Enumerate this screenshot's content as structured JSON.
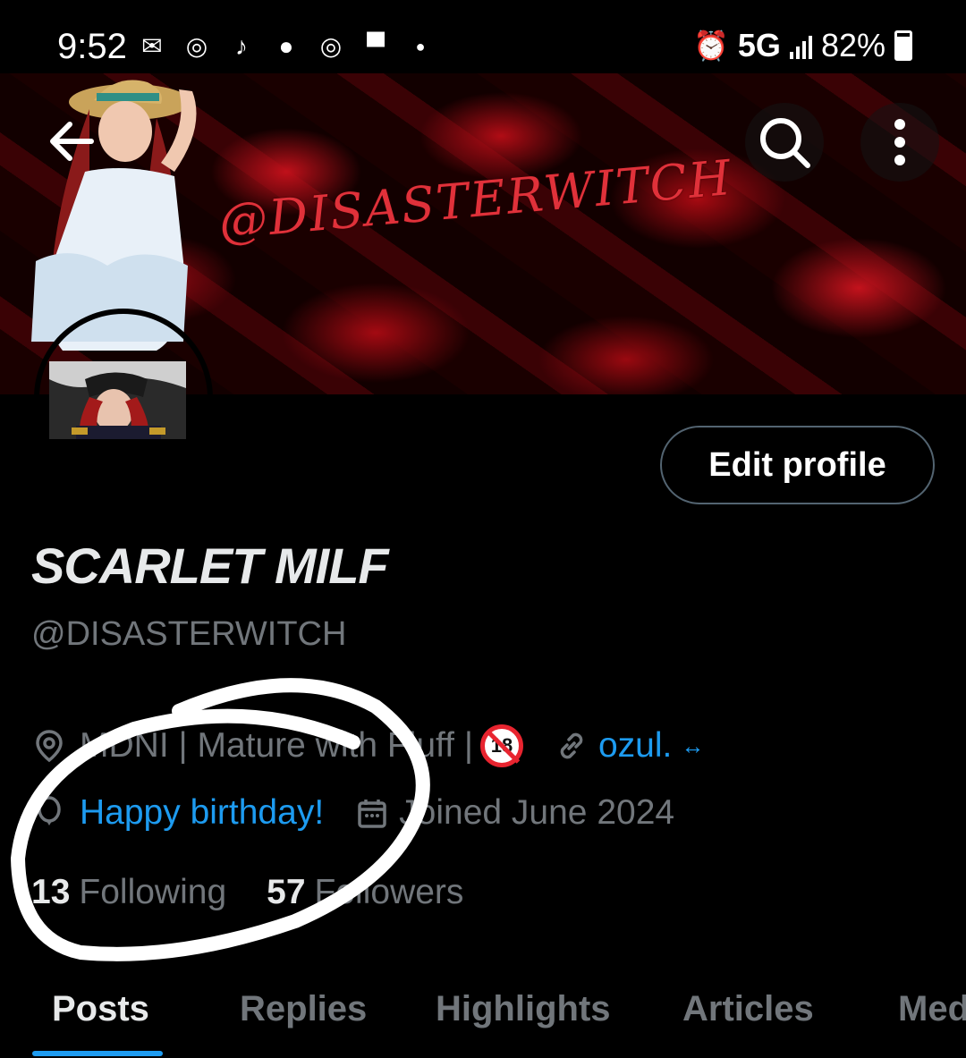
{
  "status_bar": {
    "time": "9:52",
    "notification_icons": [
      "mail-icon",
      "instagram-icon",
      "tiktok-icon",
      "tinder-icon",
      "instagram-icon",
      "top-hat-icon",
      "dot-icon"
    ],
    "alarm_icon": "alarm-icon",
    "network": "5G",
    "battery": "82%"
  },
  "banner": {
    "handle_art_text": "@DISASTERWITCH"
  },
  "profile": {
    "edit_button": "Edit profile",
    "display_name": "SCARLET MILF",
    "handle": "@DISASTERWITCH",
    "bio_location": "MDNI | Mature with Fluff |",
    "age_badge": "18",
    "website": "ozul.",
    "website_suffix": "↔",
    "birthday": "Happy birthday!",
    "joined": "Joined June 2024",
    "following_count": "13",
    "following_label": "Following",
    "followers_count": "57",
    "followers_label": "Followers"
  },
  "tabs": [
    {
      "label": "Posts",
      "active": true
    },
    {
      "label": "Replies"
    },
    {
      "label": "Highlights"
    },
    {
      "label": "Articles"
    },
    {
      "label": "Media"
    }
  ],
  "colors": {
    "accent": "#1d9bf0",
    "muted": "#71767b",
    "annotation_circle": "#ffffff"
  }
}
